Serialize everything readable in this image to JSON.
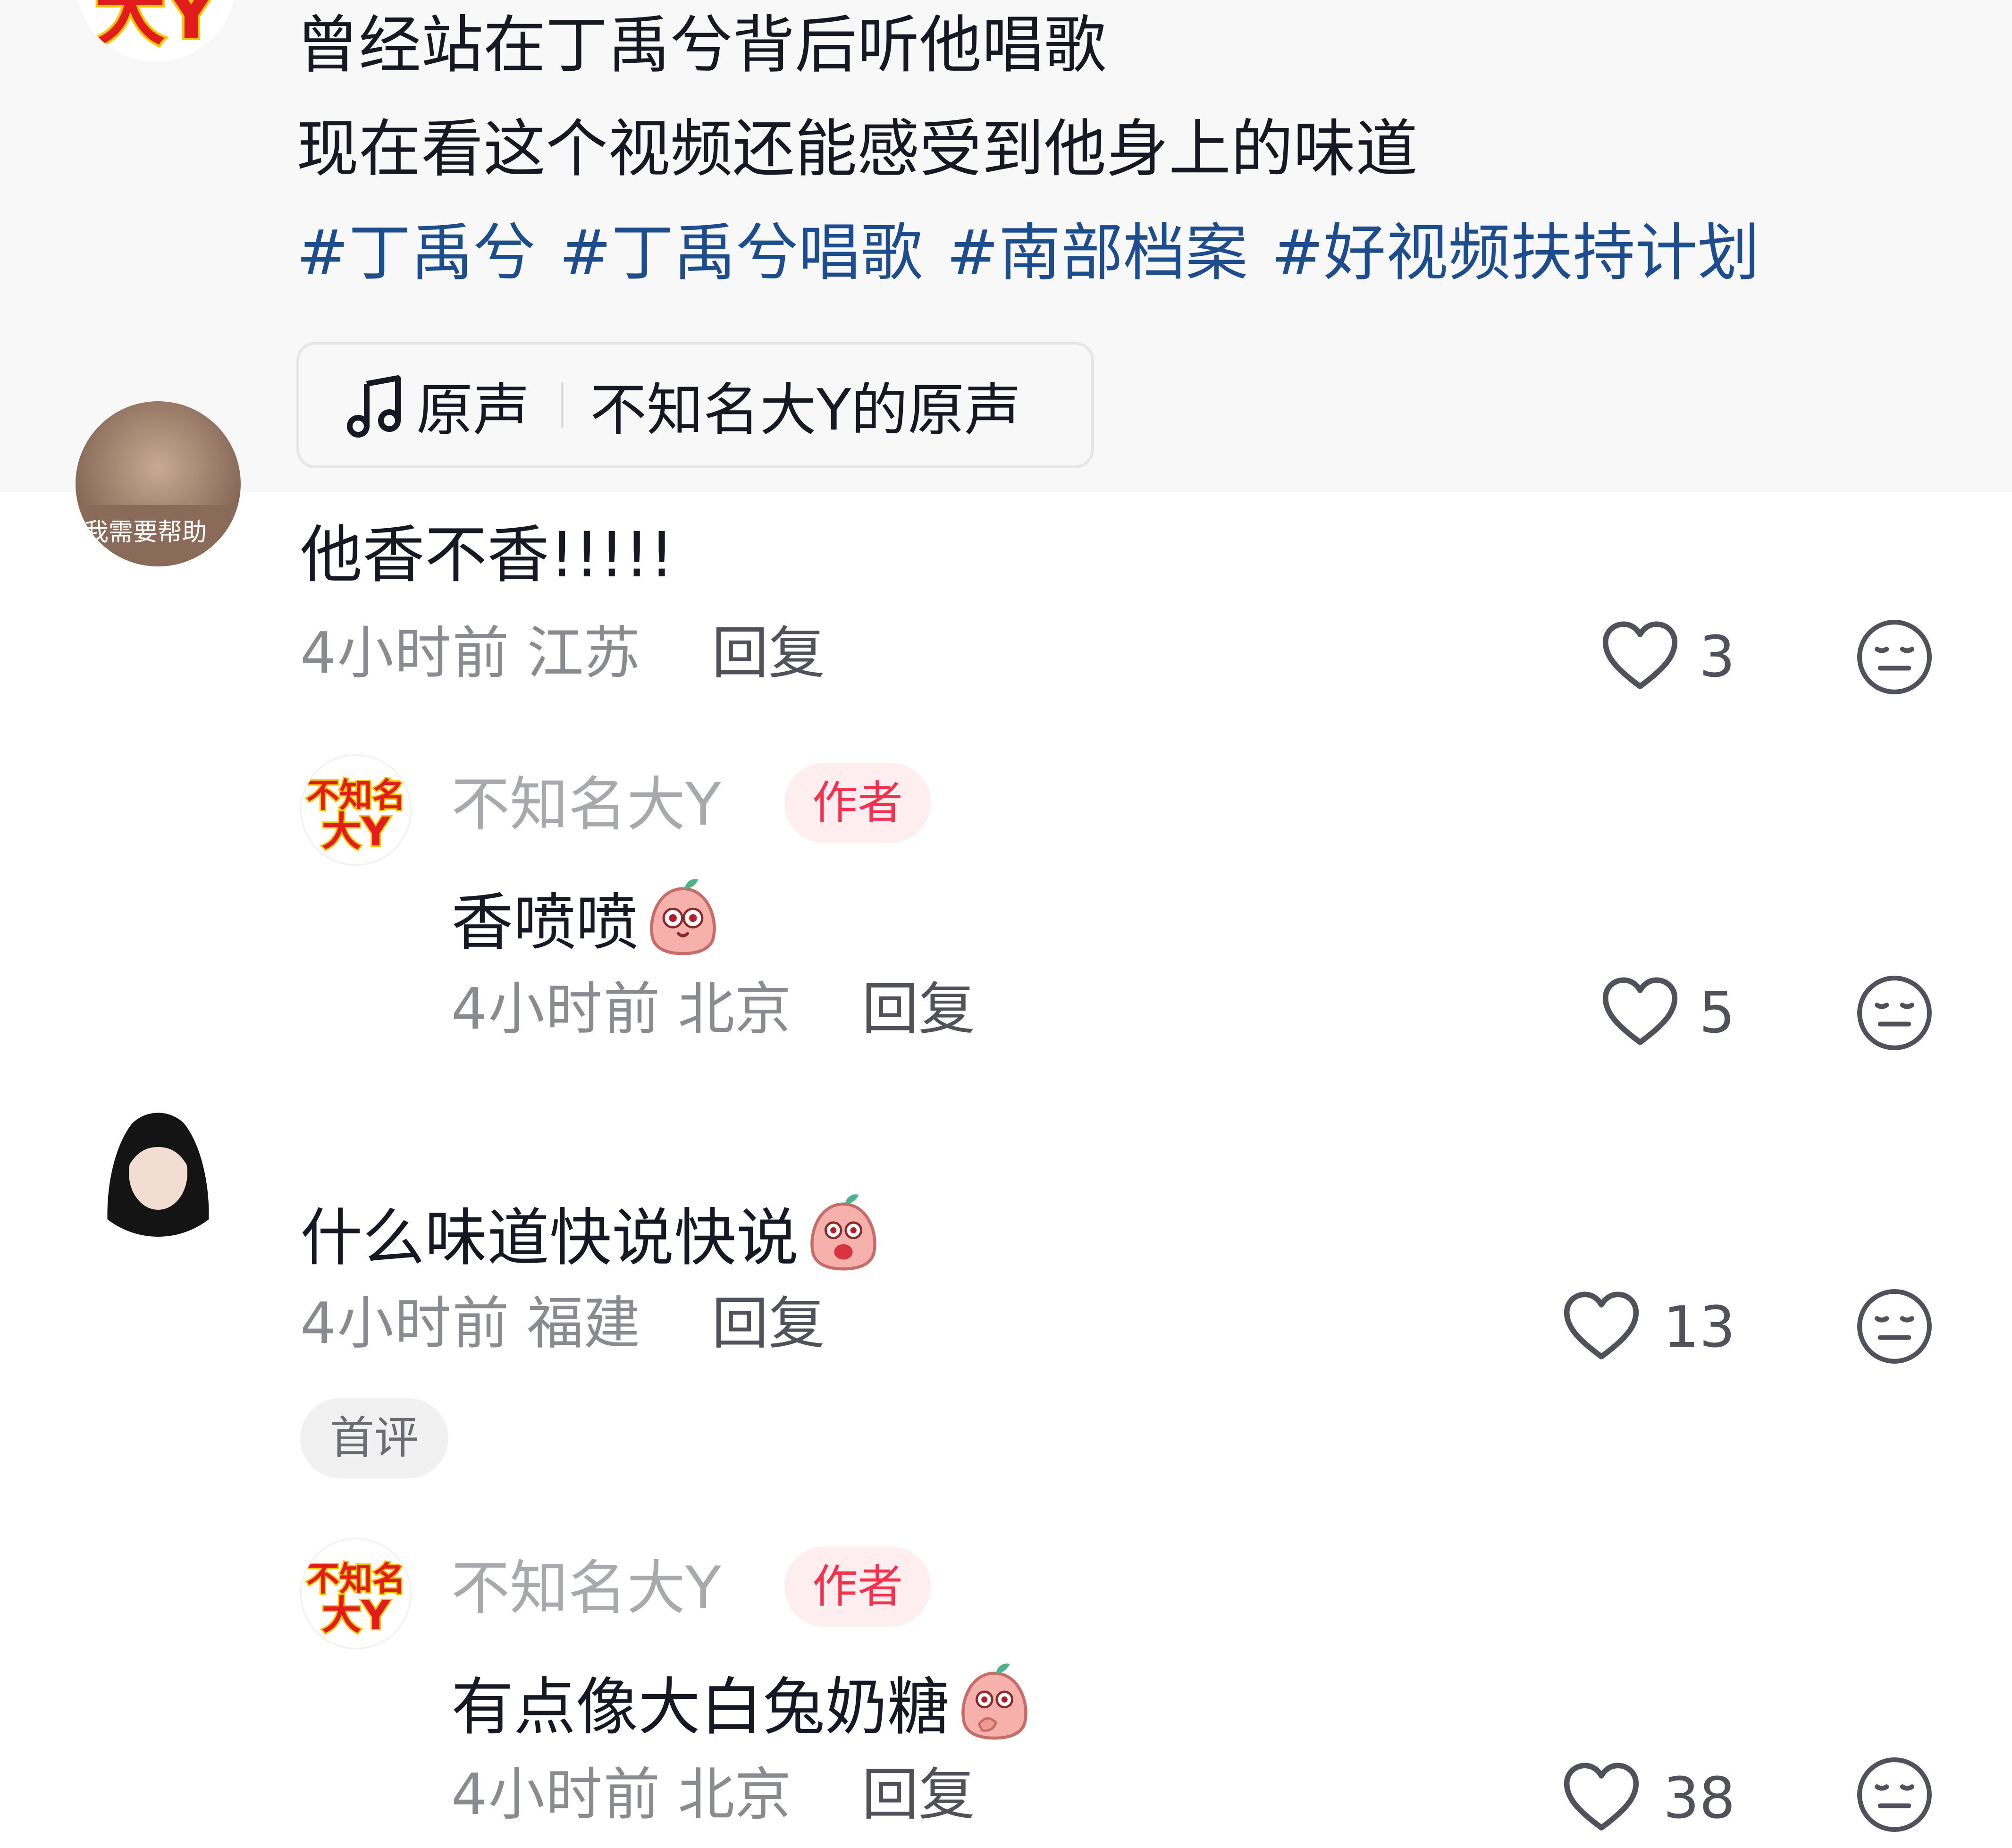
{
  "post": {
    "caption_lines": [
      "曾经站在丁禹兮背后听他唱歌",
      "现在看这个视频还能感受到他身上的味道"
    ],
    "hashtags": [
      "#丁禹兮",
      "#丁禹兮唱歌",
      "#南部档案",
      "#好视频扶持计划"
    ],
    "music": {
      "icon": "music-note-icon",
      "label": "原声",
      "name": "不知名大Y的原声"
    }
  },
  "comments": [
    {
      "avatar_caption": "我需要帮助",
      "text": "他香不香!!!!!",
      "time": "4小时前",
      "location": "江苏",
      "reply_label": "回复",
      "likes": "3",
      "replies": [
        {
          "username": "不知名大Y",
          "badge": "作者",
          "text": "香喷喷",
          "time": "4小时前",
          "location": "北京",
          "reply_label": "回复",
          "likes": "5"
        }
      ]
    },
    {
      "text": "什么味道快说快说",
      "time": "4小时前",
      "location": "福建",
      "reply_label": "回复",
      "likes": "13",
      "badge": "首评",
      "replies": [
        {
          "username": "不知名大Y",
          "badge": "作者",
          "text": "有点像大白兔奶糖",
          "time": "4小时前",
          "location": "北京",
          "reply_label": "回复",
          "likes": "38"
        }
      ]
    }
  ],
  "icons": {
    "like": "heart-outline-icon",
    "dislike": "neutral-face-icon",
    "emoji": "peach-sticker-emoji"
  },
  "colors": {
    "hashtag": "#1d4d8c",
    "author_badge_text": "#f2324f",
    "author_badge_bg": "#ffeef0",
    "meta_text": "#8a8b91"
  }
}
